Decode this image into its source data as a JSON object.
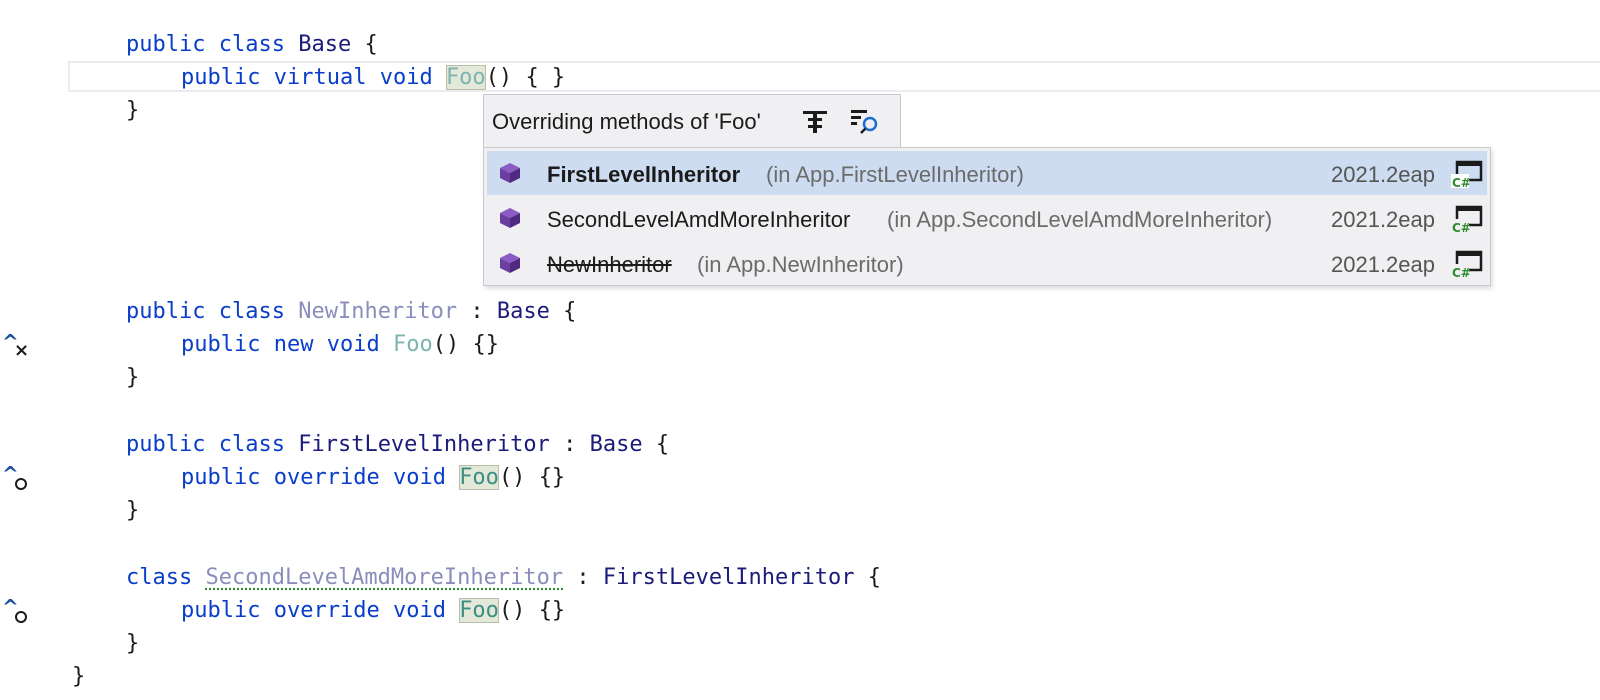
{
  "code": {
    "public": "public",
    "class": "class",
    "virtual": "virtual",
    "void": "void",
    "new": "new",
    "override": "override",
    "open_brace": "{",
    "close_brace": "}",
    "colon": ":",
    "parens": "()",
    "empty_body_spaced": "{ }",
    "empty_body": "{}",
    "base": "Base",
    "foo": "Foo",
    "new_inheritor": "NewInheritor",
    "first_level": "FirstLevelInheritor",
    "second_level": "SecondLevelAmdMoreInheritor"
  },
  "gutter": {
    "caret": "^",
    "hides_mark": "×"
  },
  "popup": {
    "title": "Overriding methods of 'Foo'",
    "header_icons": [
      "filter-hierarchy-icon",
      "find-results-icon"
    ],
    "rows": [
      {
        "name": "FirstLevelInheritor",
        "ns": "(in App.FirstLevelInheritor)",
        "version": "2021.2eap",
        "icon": "class-cube-icon",
        "project_icon": "csharp-project-icon",
        "selected": true
      },
      {
        "name": "SecondLevelAmdMoreInheritor",
        "ns": "(in App.SecondLevelAmdMoreInheritor)",
        "version": "2021.2eap",
        "icon": "class-cube-icon",
        "project_icon": "csharp-project-icon",
        "selected": false
      },
      {
        "name": "NewInheritor",
        "ns": "(in App.NewInheritor)",
        "version": "2021.2eap",
        "icon": "class-cube-icon",
        "project_icon": "csharp-project-icon",
        "selected": false,
        "struck_through": true
      }
    ]
  },
  "colors": {
    "keyword": "#0a3ec9",
    "type": "#1b1b7a",
    "unused_type": "#8b8ebd",
    "method": "#3b8f84",
    "selection": "#cddcf0",
    "cube": "#6a3fa0",
    "csharp_green": "#2e8b2e"
  }
}
